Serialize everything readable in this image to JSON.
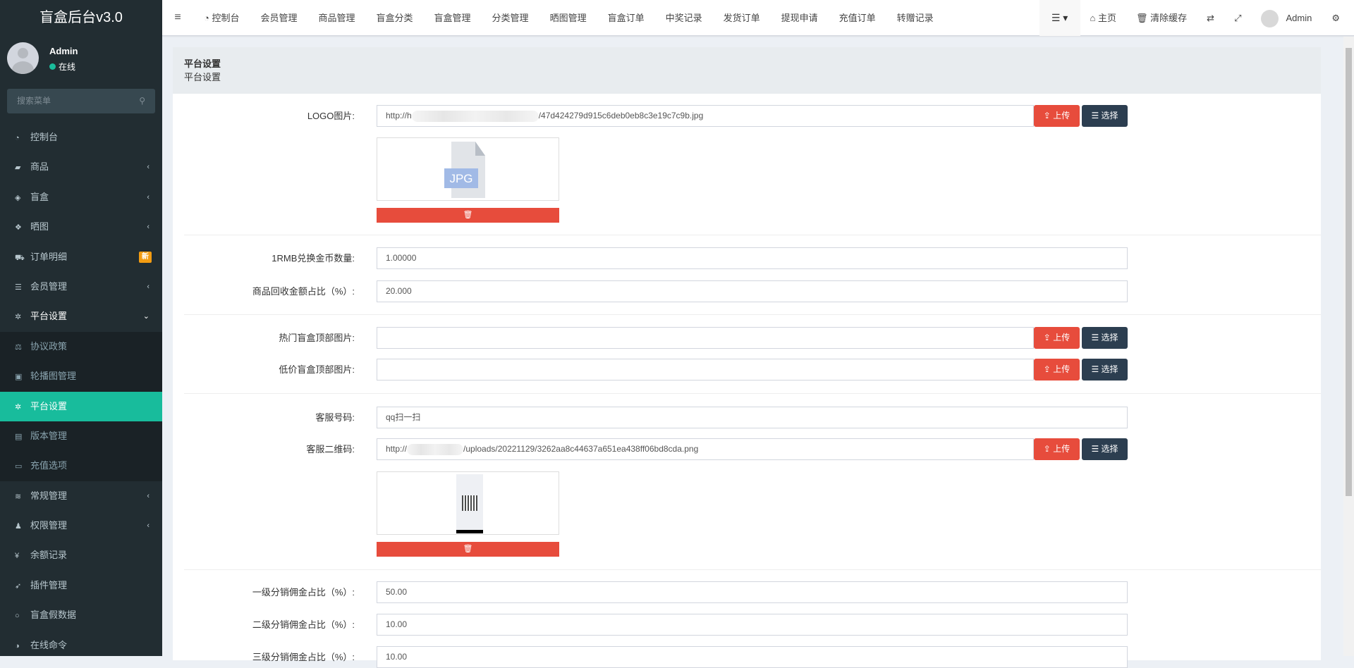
{
  "brand": "盲盒后台v3.0",
  "user": {
    "name": "Admin",
    "status": "在线"
  },
  "search": {
    "placeholder": "搜索菜单"
  },
  "sidebar": {
    "items": [
      {
        "label": "控制台",
        "icon": "dashboard-icon",
        "glyph": "◔"
      },
      {
        "label": "商品",
        "icon": "shopping-bag-icon",
        "glyph": "▰",
        "arrow": "‹"
      },
      {
        "label": "盲盒",
        "icon": "cube-icon",
        "glyph": "◈",
        "arrow": "‹"
      },
      {
        "label": "晒图",
        "icon": "dropbox-icon",
        "glyph": "❖",
        "arrow": "‹"
      },
      {
        "label": "订单明细",
        "icon": "cart-icon",
        "glyph": "⛟",
        "badge": "新"
      },
      {
        "label": "会员管理",
        "icon": "list-icon",
        "glyph": "☰",
        "arrow": "‹"
      },
      {
        "label": "平台设置",
        "icon": "gear-icon",
        "glyph": "✲",
        "arrow": "⌄"
      },
      {
        "label": "协议政策",
        "icon": "balance-scale-icon",
        "glyph": "⚖"
      },
      {
        "label": "轮播图管理",
        "icon": "image-icon",
        "glyph": "▣"
      },
      {
        "label": "平台设置",
        "icon": "gear-icon",
        "glyph": "✲"
      },
      {
        "label": "版本管理",
        "icon": "server-icon",
        "glyph": "▤"
      },
      {
        "label": "充值选项",
        "icon": "battery-icon",
        "glyph": "▭"
      },
      {
        "label": "常规管理",
        "icon": "database-icon",
        "glyph": "≋",
        "arrow": "‹"
      },
      {
        "label": "权限管理",
        "icon": "users-icon",
        "glyph": "♟",
        "arrow": "‹"
      },
      {
        "label": "余额记录",
        "icon": "yen-icon",
        "glyph": "¥"
      },
      {
        "label": "插件管理",
        "icon": "rocket-icon",
        "glyph": "➶"
      },
      {
        "label": "盲盒假数据",
        "icon": "circle-icon",
        "glyph": "○"
      },
      {
        "label": "在线命令",
        "icon": "adjust-icon",
        "glyph": "◑"
      }
    ]
  },
  "nav": {
    "items": [
      "控制台",
      "会员管理",
      "商品管理",
      "盲盒分类",
      "盲盒管理",
      "分类管理",
      "晒图管理",
      "盲盒订单",
      "中奖记录",
      "发货订单",
      "提现申请",
      "充值订单",
      "转赠记录"
    ],
    "home": "主页",
    "clear_cache": "清除缓存",
    "admin": "Admin"
  },
  "panel": {
    "title": "平台设置",
    "subtitle": "平台设置"
  },
  "buttons": {
    "upload": "上传",
    "select": "选择"
  },
  "form": {
    "logo": {
      "label": "LOGO图片:",
      "prefix": "http://h",
      "suffix": "/47d424279d915c6deb0eb8c3e19c7c9b.jpg",
      "file_badge": "JPG"
    },
    "rmb": {
      "label": "1RMB兑换金币数量:",
      "value": "1.00000"
    },
    "recycle": {
      "label": "商品回收金额占比（%）:",
      "value": "20.000"
    },
    "hot_img": {
      "label": "热门盲盒顶部图片:",
      "value": ""
    },
    "cheap_img": {
      "label": "低价盲盒顶部图片:",
      "value": ""
    },
    "service_no": {
      "label": "客服号码:",
      "value": "qq扫一扫"
    },
    "service_qr": {
      "label": "客服二维码:",
      "prefix": "http://",
      "suffix": "/uploads/20221129/3262aa8c44637a651ea438ff06bd8cda.png"
    },
    "level1": {
      "label": "一级分销佣金占比（%）:",
      "value": "50.00"
    },
    "level2": {
      "label": "二级分销佣金占比（%）:",
      "value": "10.00"
    },
    "level3": {
      "label": "三级分销佣金占比（%）:",
      "value": "10.00"
    }
  }
}
